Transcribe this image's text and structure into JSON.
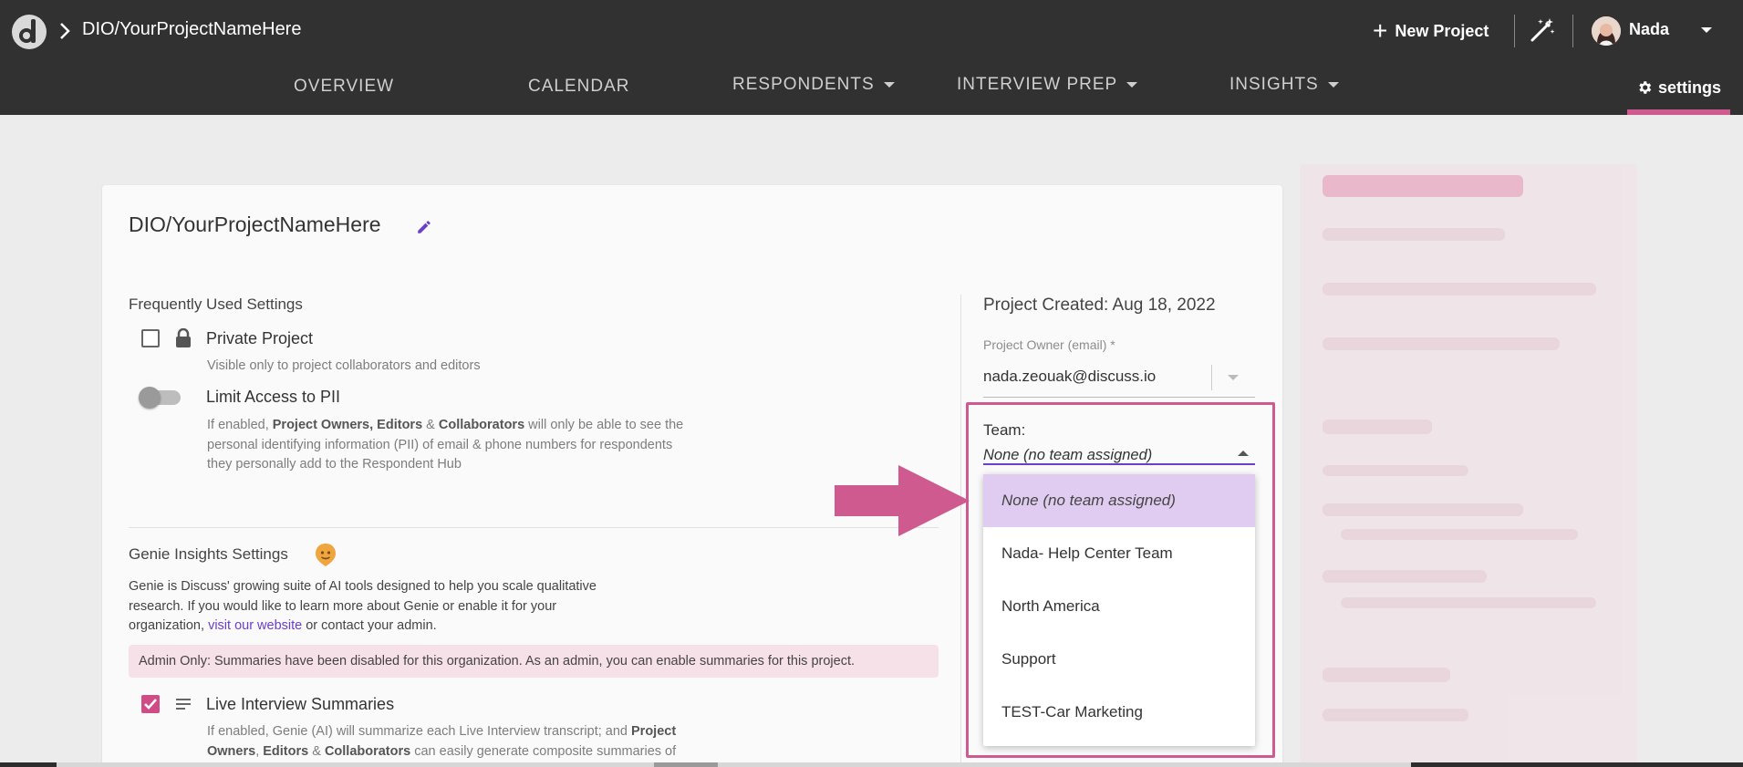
{
  "header": {
    "breadcrumb": "DIO/YourProjectNameHere",
    "new_project_label": "New Project",
    "user_name": "Nada"
  },
  "nav": {
    "items": [
      {
        "label": "OVERVIEW"
      },
      {
        "label": "CALENDAR"
      },
      {
        "label": "RESPONDENTS"
      },
      {
        "label": "INTERVIEW PREP"
      },
      {
        "label": "INSIGHTS"
      }
    ],
    "settings_label": "settings",
    "active": "settings"
  },
  "project": {
    "title": "DIO/YourProjectNameHere",
    "created": "Project Created: Aug 18, 2022"
  },
  "frequent": {
    "heading": "Frequently Used Settings",
    "private": {
      "label": "Private Project",
      "helper": "Visible only to project collaborators and editors",
      "checked": false
    },
    "pii": {
      "label": "Limit Access to PII",
      "helper_1": "If enabled, ",
      "b1": "Project Owners, Editors",
      "helper_2": " & ",
      "b2": "Collaborators",
      "helper_3": " will only be able to see the",
      "line2": "personal identifying information (PII) of email & phone numbers for respondents",
      "line3": "they personally add to the Respondent Hub",
      "enabled": false
    }
  },
  "genie": {
    "heading": "Genie Insights Settings",
    "line1": "Genie is Discuss' growing suite of AI tools designed to help you scale qualitative",
    "line2": "research. If you would like to learn more about Genie or enable it for your",
    "line3_pre": "organization, ",
    "link": "visit our website",
    "line3_post": " or contact your admin.",
    "admin_banner": "Admin Only: Summaries have been disabled for this organization. As an admin, you can enable summaries for this project.",
    "live": {
      "label": "Live Interview Summaries",
      "checked": true,
      "h1": "If enabled, Genie (AI) will summarize each Live Interview transcript; and ",
      "b1": "Project",
      "b2": "Owners",
      "h2": ", ",
      "b3": "Editors",
      "h3": " & ",
      "b4": "Collaborators",
      "h4": " can easily generate composite summaries of"
    }
  },
  "owner": {
    "label": "Project Owner (email) *",
    "value": "nada.zeouak@discuss.io"
  },
  "team": {
    "label": "Team:",
    "value": "None (no team assigned)",
    "options": [
      "None (no team assigned)",
      "Nada- Help Center Team",
      "North America",
      "Support",
      "TEST-Car Marketing"
    ],
    "selected_index": 0
  },
  "colors": {
    "accent_pink": "#cf5a90",
    "accent_purple": "#6b3fc6",
    "topbar": "#313131"
  }
}
